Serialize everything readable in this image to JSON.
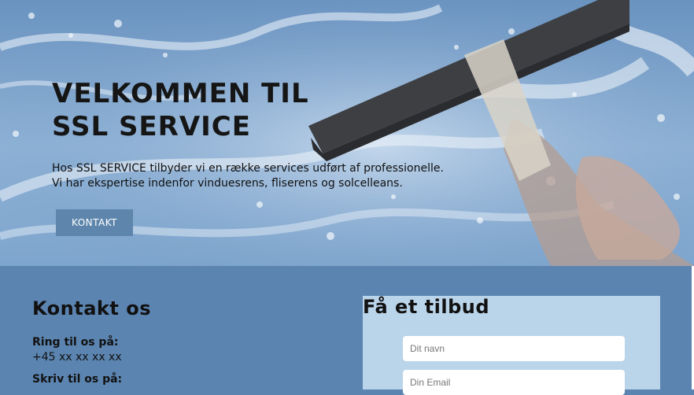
{
  "hero": {
    "title_line1": "VELKOMMEN TIL",
    "title_line2": "SSL SERVICE",
    "description_line1": "Hos SSL SERVICE tilbyder vi en række services udført af professionelle.",
    "description_line2": "Vi har ekspertise indenfor vinduesrens, fliserens og solcelleans.",
    "button_label": "KONTAKT"
  },
  "contact": {
    "heading": "Kontakt os",
    "phone_label": "Ring til os på:",
    "phone_value": "+45 xx xx xx xx",
    "write_label": "Skriv til os på:"
  },
  "quote": {
    "heading": "Få et tilbud",
    "name_placeholder": "Dit navn",
    "email_placeholder": "Din Email"
  },
  "colors": {
    "section_bg": "#5b84b0",
    "button_bg": "#5e86ad",
    "panel_bg": "#bad4ea"
  }
}
